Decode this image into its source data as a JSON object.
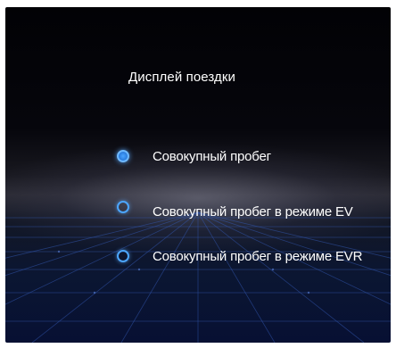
{
  "screen": {
    "title": "Дисплей поездки"
  },
  "options": [
    {
      "label": "Совокупный пробег",
      "selected": true
    },
    {
      "label": "Совокупный пробег в режиме EV",
      "selected": false
    },
    {
      "label": "Совокупный пробег в режиме EVR",
      "selected": false
    }
  ],
  "colors": {
    "accent": "#4ca6ff",
    "background": "#05050a",
    "grid": "#2a4a9a",
    "text": "#ffffff"
  }
}
